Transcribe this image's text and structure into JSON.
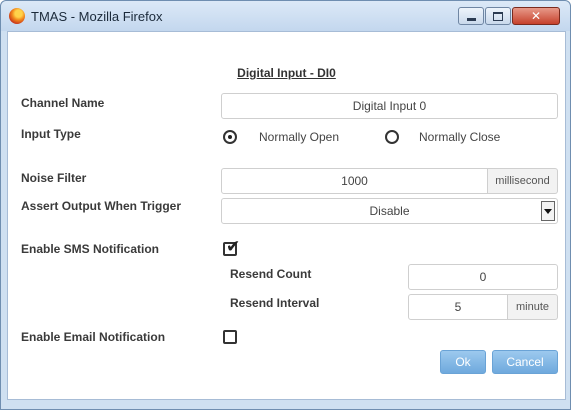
{
  "window": {
    "title": "TMAS - Mozilla Firefox",
    "close_glyph": "✕"
  },
  "heading": "Digital Input - DI0",
  "labels": {
    "channel_name": "Channel Name",
    "input_type": "Input Type",
    "noise_filter": "Noise Filter",
    "assert_output_when_trigger": "Assert Output When Trigger",
    "enable_sms": "Enable SMS Notification",
    "resend_count": "Resend Count",
    "resend_interval": "Resend Interval",
    "enable_email": "Enable Email Notification"
  },
  "fields": {
    "channel_name_value": "Digital Input 0",
    "input_type_options": [
      {
        "label": "Normally Open",
        "selected": true
      },
      {
        "label": "Normally Close",
        "selected": false
      }
    ],
    "noise_filter_value": "1000",
    "noise_filter_unit": "millisecond",
    "assert_output_value": "Disable",
    "enable_sms_checked": true,
    "resend_count_value": "0",
    "resend_interval_value": "5",
    "resend_interval_unit": "minute",
    "enable_email_checked": false
  },
  "buttons": {
    "ok": "Ok",
    "cancel": "Cancel"
  }
}
